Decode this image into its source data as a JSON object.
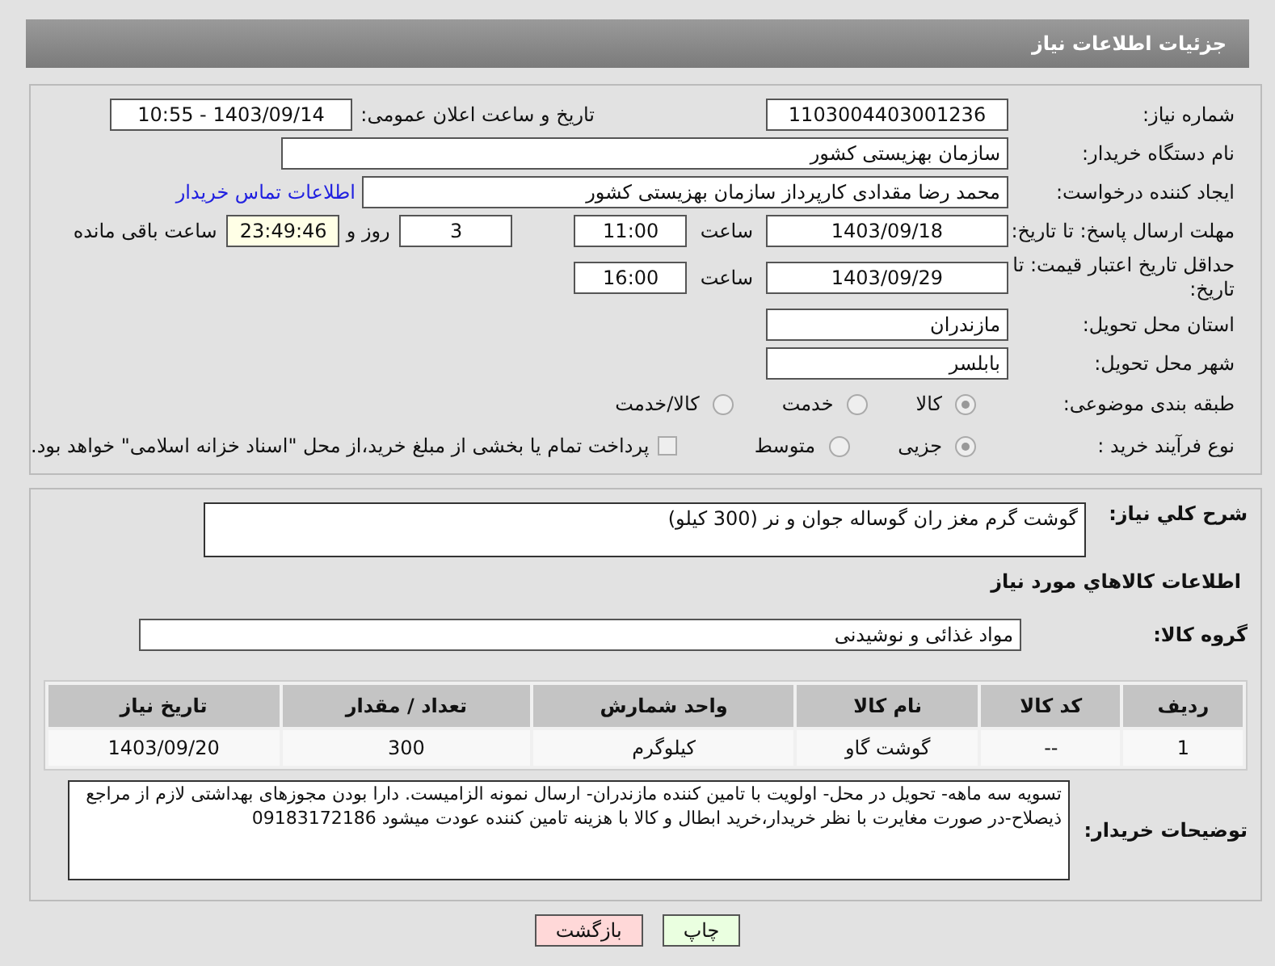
{
  "header": {
    "title": "جزئیات اطلاعات نیاز"
  },
  "need_number": {
    "label": "شماره نیاز:",
    "value": "1103004403001236"
  },
  "announce": {
    "label": "تاریخ و ساعت اعلان عمومی:",
    "value": "1403/09/14 - 10:55"
  },
  "buyer_org": {
    "label": "نام دستگاه خریدار:",
    "value": "سازمان بهزیستی کشور"
  },
  "requester": {
    "label": "ایجاد کننده درخواست:",
    "value": "محمد رضا  مقدادی کارپرداز سازمان بهزیستی کشور",
    "link": "اطلاعات تماس خریدار"
  },
  "reply_deadline": {
    "label": "مهلت ارسال پاسخ: تا تاریخ:",
    "date": "1403/09/18",
    "time_label": "ساعت",
    "time": "11:00",
    "days": "3",
    "days_label": "روز و",
    "remaining": "23:49:46",
    "remaining_label": "ساعت باقی مانده"
  },
  "price_validity": {
    "label": "حداقل تاریخ اعتبار قیمت: تا تاریخ:",
    "date": "1403/09/29",
    "time_label": "ساعت",
    "time": "16:00"
  },
  "province": {
    "label": "استان محل تحویل:",
    "value": "مازندران"
  },
  "city": {
    "label": "شهر محل تحویل:",
    "value": "بابلسر"
  },
  "category": {
    "label": "طبقه بندی موضوعی:",
    "options": [
      {
        "label": "کالا",
        "selected": true
      },
      {
        "label": "خدمت",
        "selected": false
      },
      {
        "label": "کالا/خدمت",
        "selected": false
      }
    ]
  },
  "process": {
    "label": "نوع فرآیند خرید :",
    "options": [
      {
        "label": "جزیی",
        "selected": true
      },
      {
        "label": "متوسط",
        "selected": false
      }
    ],
    "treasury": {
      "checked": false,
      "label": "پرداخت تمام یا بخشی از مبلغ خرید،از محل \"اسناد خزانه اسلامی\" خواهد بود."
    }
  },
  "description": {
    "label": "شرح کلي نياز:",
    "value": "گوشت گرم مغز ران گوساله جوان و نر (300 کیلو)"
  },
  "goods_heading": "اطلاعات کالاهاي مورد نياز",
  "goods_group": {
    "label": "گروه کالا:",
    "value": "مواد غذائی و نوشیدنی"
  },
  "table": {
    "columns": [
      "رديف",
      "کد کالا",
      "نام کالا",
      "واحد شمارش",
      "تعداد / مقدار",
      "تاريخ نياز"
    ],
    "rows": [
      [
        "1",
        "--",
        "گوشت گاو",
        "کیلوگرم",
        "300",
        "1403/09/20"
      ]
    ]
  },
  "buyer_notes": {
    "label": "توضیحات خریدار:",
    "value": "تسویه سه ماهه- تحویل در محل- اولویت با تامین کننده مازندران- ارسال نمونه الزامیست. دارا بودن مجوزهای بهداشتی لازم از مراجع ذیصلاح-در صورت مغایرت با نظر خریدار،خرید ابطال و کالا با هزینه تامین کننده عودت میشود 09183172186"
  },
  "buttons": [
    {
      "label": "چاپ",
      "kind": "print"
    },
    {
      "label": "بازگشت",
      "kind": "back"
    }
  ]
}
